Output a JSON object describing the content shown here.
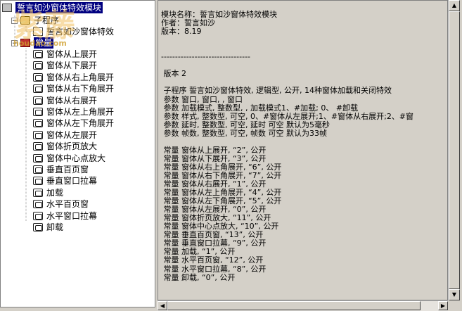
{
  "tree": {
    "root_label": "誓言如沙窗体特效模块",
    "subprogram_label": "子程序",
    "subprogram_child": "誓言如沙窗体特效",
    "const_label": "常量",
    "const_items": [
      "窗体从上展开",
      "窗体从下展开",
      "窗体从右上角展开",
      "窗体从右下角展开",
      "窗体从右展开",
      "窗体从左上角展开",
      "窗体从左下角展开",
      "窗体从左展开",
      "窗体折页放大",
      "窗体中心点放大",
      "垂直百页窗",
      "垂直窗口拉幕",
      "加载",
      "水平百页窗",
      "水平窗口拉幕",
      "卸载"
    ]
  },
  "watermark": {
    "site": "houdao.com"
  },
  "content": {
    "lines": [
      "模块名称：誓言如沙窗体特效模块",
      "作者：誓言如沙",
      "版本：8.19",
      "",
      "",
      "--------------------------------",
      "",
      " 版本 2",
      "",
      " 子程序 誓言如沙窗体特效, 逻辑型, 公开, 14种窗体加载和关闭特效",
      " 参数 窗口, 窗口, , 窗口",
      " 参数 加载模式, 整数型, , 加载模式1、#加载; 0、 #卸载",
      " 参数 样式, 整数型, 可空, 0、#窗体从左展开;1、#窗体从右展开;2、#窗",
      " 参数 延时, 整数型, 可空, 延时 可空 默认为5毫秒",
      " 参数 帧数, 整数型, 可空, 帧数 可空 默认为33帧",
      "",
      " 常量 窗体从上展开, “2”, 公开",
      " 常量 窗体从下展开, “3”, 公开",
      " 常量 窗体从右上角展开, “6”, 公开",
      " 常量 窗体从右下角展开, “7”, 公开",
      " 常量 窗体从右展开, “1”, 公开",
      " 常量 窗体从左上角展开, “4”, 公开",
      " 常量 窗体从左下角展开, “5”, 公开",
      " 常量 窗体从左展开, “0”, 公开",
      " 常量 窗体折页放大, “11”, 公开",
      " 常量 窗体中心点放大, “10”, 公开",
      " 常量 垂直百页窗, “13”, 公开",
      " 常量 垂直窗口拉幕, “9”, 公开",
      " 常量 加载, “1”, 公开",
      " 常量 水平百页窗, “12”, 公开",
      " 常量 水平窗口拉幕, “8”, 公开",
      " 常量 卸载, “0”, 公开"
    ]
  },
  "colors": {
    "selection": "#000080",
    "panel": "#d4d0c8"
  }
}
